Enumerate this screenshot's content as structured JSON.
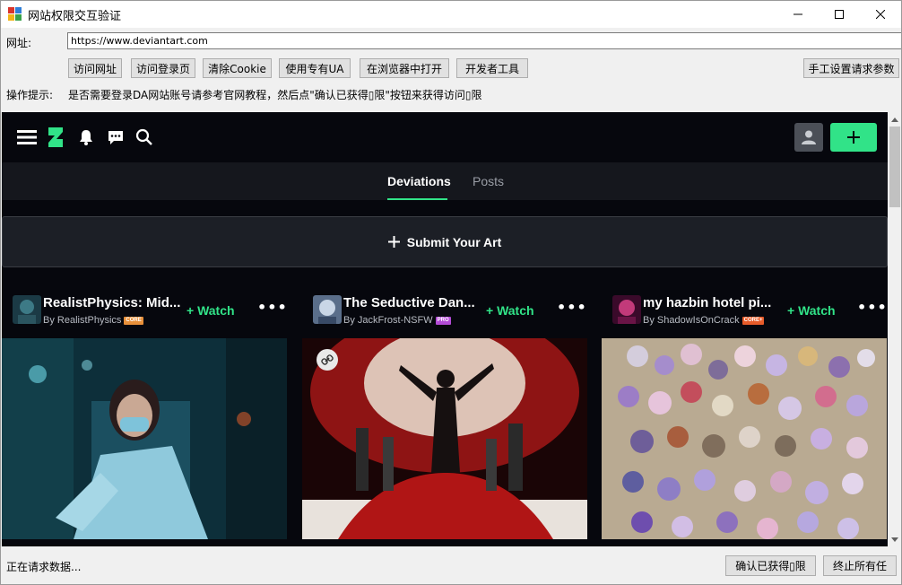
{
  "window": {
    "title": "网站权限交互验证",
    "minimize_glyph": "—",
    "close_glyph": "✕"
  },
  "form": {
    "url_label": "网址:",
    "url_value": "https://www.deviantart.com",
    "tip_label": "操作提示:",
    "tip_text": "是否需要登录DA网站账号请参考官网教程，然后点\"确认已获得▯限\"按钮来获得访问▯限"
  },
  "toolbar": {
    "visit_url": "访问网址",
    "visit_login": "访问登录页",
    "clear_cookie": "清除Cookie",
    "use_ua": "使用专有UA",
    "open_in_browser": "在浏览器中打开",
    "devtools": "开发者工具",
    "manual_params": "手工设置请求参数"
  },
  "deviantart": {
    "tabs": [
      "Deviations",
      "Posts"
    ],
    "submit_label": "Submit Your Art",
    "cards": [
      {
        "title": "RealistPhysics: Mid...",
        "by": "By RealistPhysics",
        "badge": "CORE",
        "watch": "Watch",
        "more": "•••"
      },
      {
        "title": "The Seductive Dan...",
        "by": "By JackFrost-NSFW",
        "badge": "PRO",
        "watch": "Watch",
        "more": "•••"
      },
      {
        "title": "my hazbin hotel pi...",
        "by": "By ShadowIsOnCrack",
        "badge": "CORE+",
        "watch": "Watch",
        "more": "•••"
      }
    ]
  },
  "status": {
    "text": "正在请求数据...",
    "confirm_btn": "确认已获得▯限",
    "stop_btn": "终止所有任"
  },
  "colors": {
    "da_green": "#31e388",
    "da_bg": "#06070d",
    "badge_core": "#e8903a",
    "badge_pro": "#b34bd6",
    "badge_coreplus": "#e85c2a"
  }
}
